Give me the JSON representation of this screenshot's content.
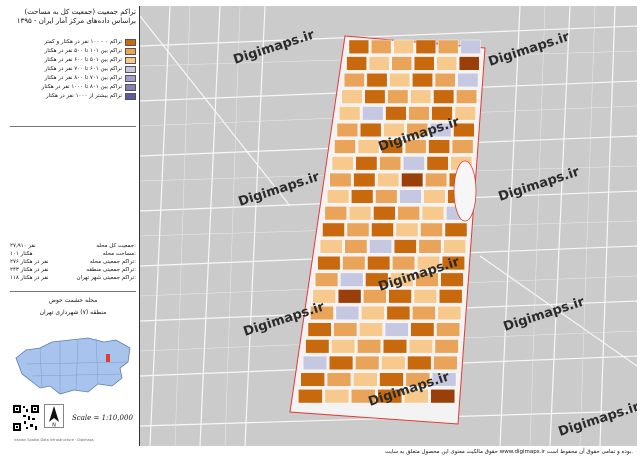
{
  "panel": {
    "title_line1": "تراکم جمعیت (جمعیت کل به مساحت)",
    "title_line2": "براساس داده‌های مرکز آمار ایران - ۱۳۹۵",
    "legend": [
      {
        "label": "تراکم ۰ - ۱۰۰ نفر در هکتار و کمتر",
        "color": "#c8690e"
      },
      {
        "label": "تراکم بین ۱۰۱ تا ۵۰۰ نفر در هکتار",
        "color": "#e9a45a"
      },
      {
        "label": "تراکم بین ۵۰۱ تا ۶۰۰ نفر در هکتار",
        "color": "#f7c98c"
      },
      {
        "label": "تراکم بین ۶۰۱ تا ۷۰۰ نفر در هکتار",
        "color": "#c6c7e0"
      },
      {
        "label": "تراکم بین ۷۰۱ تا ۸۰۰ نفر در هکتار",
        "color": "#9d9fce"
      },
      {
        "label": "تراکم بین ۸۰۱ تا ۱۰۰۰ نفر در هکتار",
        "color": "#7f80bd"
      },
      {
        "label": "تراکم بیشتر از ۱۰۰۰ نفر در هکتار",
        "color": "#5a5aa6"
      }
    ],
    "stats": [
      {
        "key": "جمعیت کل محله:",
        "value": "۲۷٫۹۱۰ نفر"
      },
      {
        "key": "مساحت محله:",
        "value": "۱۰۱ هکتار"
      },
      {
        "key": "تراکم جمعیتی محله:",
        "value": "۲۷۶ نفر در هکتار"
      },
      {
        "key": "تراکم جمعیتی منطقه:",
        "value": "۲۴۳ نفر در هکتار"
      },
      {
        "key": "تراکم جمعیتی شهر تهران:",
        "value": "۱۱۸ نفر در هکتار"
      }
    ],
    "area_name": "محله حشمت حوض",
    "area_region": "منطقه (۷) شهرداری تهران",
    "scale": "Scale = 1:10,000",
    "footer_small": "Iranian Spatial Data Infrastructure · Digimaps"
  },
  "map": {
    "watermark": "Digimaps.ir"
  },
  "footer": "حقوق مالکیت معنوی این محصول متعلق به سایت www.digimaps.ir بوده و تمامی حقوق آن محفوظ است."
}
